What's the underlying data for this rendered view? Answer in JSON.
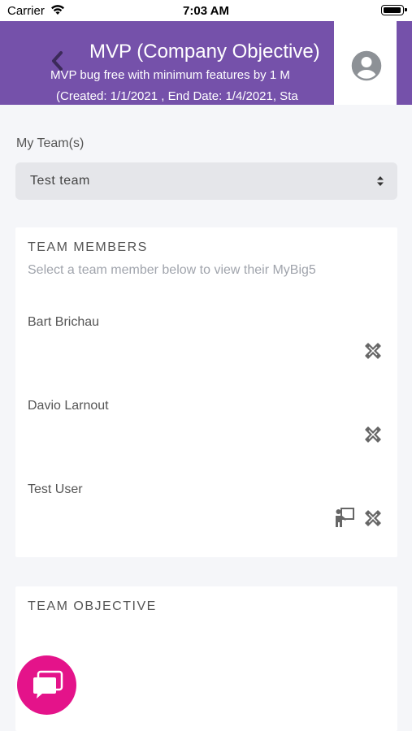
{
  "status_bar": {
    "carrier": "Carrier",
    "time": "7:03 AM"
  },
  "header": {
    "title": "MVP (Company Objective)",
    "subtitle": "MVP bug free with minimum features by 1 M",
    "dates": "(Created: 1/1/2021 , End Date: 1/4/2021, Sta"
  },
  "teams": {
    "label": "My Team(s)",
    "selected": "Test team"
  },
  "members_card": {
    "heading": "TEAM MEMBERS",
    "subheading": "Select a team member below to view their MyBig5",
    "members": [
      {
        "name": "Bart Brichau"
      },
      {
        "name": "Davio Larnout"
      },
      {
        "name": "Test User"
      }
    ]
  },
  "objective_card": {
    "heading": "TEAM OBJECTIVE"
  },
  "icons": {
    "back": "chevron-left-icon",
    "avatar": "user-circle-icon",
    "tools": "tools-icon",
    "presentation": "presenter-icon",
    "chat": "chat-icon"
  },
  "colors": {
    "header": "#7551aa",
    "fab": "#e4138a",
    "background": "#f5f6f9",
    "card": "#ffffff"
  }
}
